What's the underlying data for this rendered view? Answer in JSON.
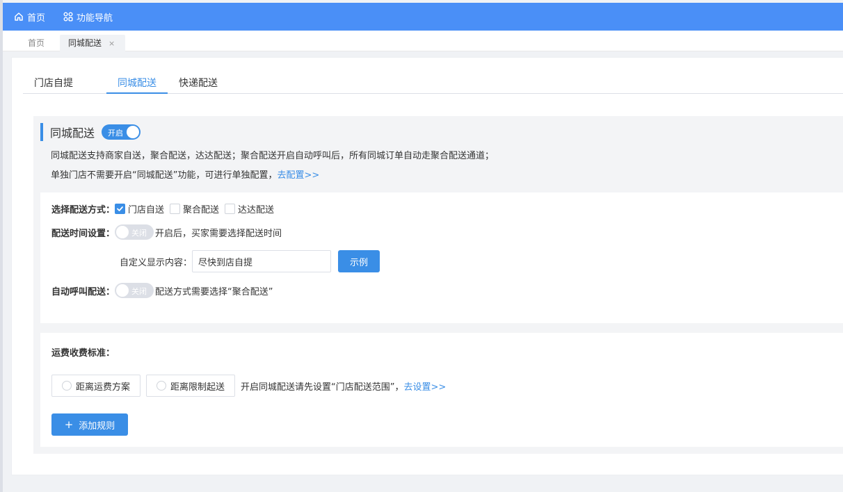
{
  "topnav": {
    "home": "首页",
    "func_nav": "功能导航"
  },
  "page_tabs": {
    "home": "首页",
    "active": "同城配送",
    "close": "×"
  },
  "tabs": [
    "门店自提",
    "同城配送",
    "快递配送"
  ],
  "section": {
    "title": "同城配送",
    "toggle": "开启",
    "desc1": "同城配送支持商家自送，聚合配送，达达配送；聚合配送开启自动呼叫后，所有同城订单自动走聚合配送通道；",
    "desc2_prefix": "单独门店不需要开启“同城配送”功能，可进行单独配置，",
    "desc2_link": "去配置>>"
  },
  "delivery_method": {
    "label": "选择配送方式：",
    "options": [
      {
        "label": "门店自送",
        "checked": true
      },
      {
        "label": "聚合配送",
        "checked": false
      },
      {
        "label": "达达配送",
        "checked": false
      }
    ]
  },
  "time_setting": {
    "label": "配送时间设置：",
    "toggle": "关闭",
    "hint": "开启后，买家需要选择配送时间",
    "custom_label": "自定义显示内容：",
    "custom_value": "尽快到店自提",
    "example_button": "示例"
  },
  "auto_call": {
    "label": "自动呼叫配送：",
    "toggle": "关闭",
    "hint": "配送方式需要选择“聚合配送”"
  },
  "fee": {
    "label": "运费收费标准：",
    "options": [
      "距离运费方案",
      "距离限制起送"
    ],
    "hint_prefix": "开启同城配送请先设置“门店配送范围”，",
    "hint_link": "去设置>>",
    "add_rule": "添加规则",
    "add_icon": "+"
  },
  "colors": {
    "accent": "#3a8ee6",
    "topnav": "#4a8ff7"
  }
}
